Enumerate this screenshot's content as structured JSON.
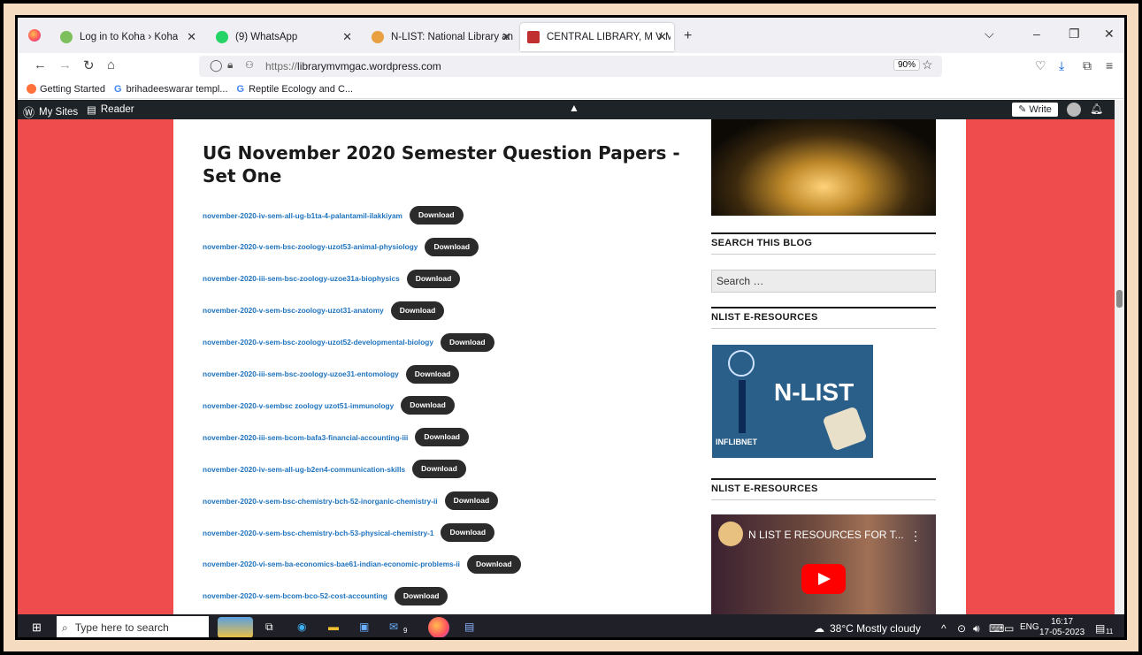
{
  "tabs": [
    {
      "label": "Log in to Koha › Koha",
      "active": false
    },
    {
      "label": "(9) WhatsApp",
      "active": false
    },
    {
      "label": "N-LIST: National Library and Inf",
      "active": false
    },
    {
      "label": "CENTRAL LIBRARY, M V MUTH",
      "active": true
    }
  ],
  "url": {
    "prefix": "https://",
    "domain": "librarymvmgac.wordpress.com",
    "zoom": "90%"
  },
  "bookmarks": [
    "Getting Started",
    "brihadeeswarar templ...",
    "Reptile Ecology and C..."
  ],
  "adminbar": {
    "my_sites": "My Sites",
    "reader": "Reader",
    "write": "Write"
  },
  "post": {
    "title": "UG November 2020 Semester Question Papers - Set One",
    "download_label": "Download",
    "items": [
      "november-2020-iv-sem-all-ug-b1ta-4-palantamil-ilakkiyam",
      "november-2020-v-sem-bsc-zoology-uzot53-animal-physiology",
      "november-2020-iii-sem-bsc-zoology-uzoe31a-biophysics",
      "november-2020-v-sem-bsc-zoology-uzot31-anatomy",
      "november-2020-v-sem-bsc-zoology-uzot52-developmental-biology",
      "november-2020-iii-sem-bsc-zoology-uzoe31-entomology",
      "november-2020-v-sembsc zoology uzot51-immunology",
      "november-2020-iii-sem-bcom-bafa3-financial-accounting-iii",
      "november-2020-iv-sem-all-ug-b2en4-communication-skills",
      "november-2020-v-sem-bsc-chemistry-bch-52-inorganic-chemistry-ii",
      "november-2020-v-sem-bsc-chemistry-bch-53-physical-chemistry-1",
      "november-2020-vi-sem-ba-economics-bae61-indian-economic-problems-ii",
      "november-2020-v-sem-bcom-bco-52-cost-accounting"
    ]
  },
  "sidebar": {
    "search_title": "SEARCH THIS BLOG",
    "search_placeholder": "Search …",
    "nlist_title_1": "NLIST E-RESOURCES",
    "nlist_title_2": "NLIST E-RESOURCES",
    "nlist_logo_text": "N-LIST",
    "inflibnet_text": "INFLIBNET",
    "video_title": "N LIST E RESOURCES FOR T..."
  },
  "taskbar": {
    "search_placeholder": "Type here to search",
    "weather": "38°C  Mostly cloudy",
    "lang": "ENG",
    "time": "16:17",
    "date": "17-05-2023",
    "badge": "9",
    "notif_count": "11"
  },
  "colors": {
    "page_bg": "#ef4d4d",
    "link": "#1e73be",
    "button": "#2b2b2b",
    "adminbar": "#1d2327"
  }
}
